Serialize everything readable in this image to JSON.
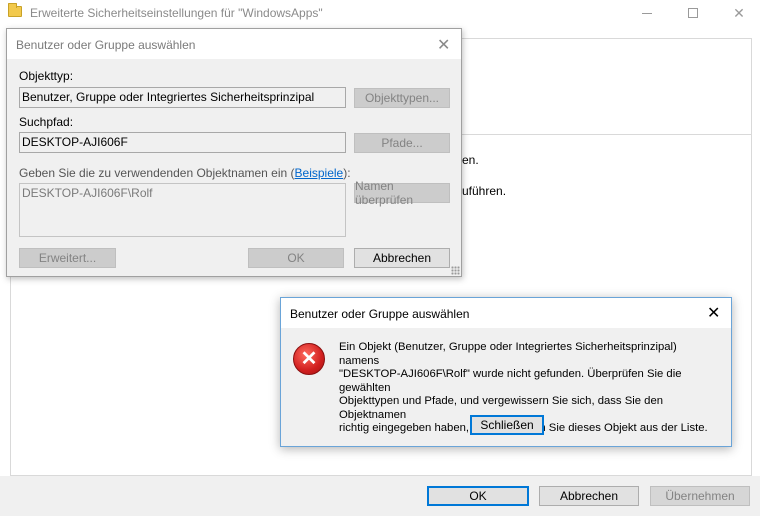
{
  "main_window": {
    "title": "Erweiterte Sicherheitseinstellungen für \"WindowsApps\"",
    "fragment_1": "en.",
    "fragment_2": "uführen.",
    "ok_label": "OK",
    "cancel_label": "Abbrechen",
    "apply_label": "Übernehmen"
  },
  "select_dialog": {
    "title": "Benutzer oder Gruppe auswählen",
    "object_type_label": "Objekttyp:",
    "object_type_value": "Benutzer, Gruppe oder Integriertes Sicherheitsprinzipal",
    "object_types_button": "Objekttypen...",
    "location_label": "Suchpfad:",
    "location_value": "DESKTOP-AJI606F",
    "locations_button": "Pfade...",
    "names_label_prefix": "Geben Sie die zu verwendenden Objektnamen ein (",
    "names_label_link": "Beispiele",
    "names_label_suffix": "):",
    "names_value": "DESKTOP-AJI606F\\Rolf",
    "check_names_button": "Namen überprüfen",
    "advanced_button": "Erweitert...",
    "ok_button": "OK",
    "cancel_button": "Abbrechen"
  },
  "error_dialog": {
    "title": "Benutzer oder Gruppe auswählen",
    "message_line_1": "Ein Objekt (Benutzer, Gruppe oder Integriertes Sicherheitsprinzipal) namens",
    "message_line_2": "\"DESKTOP-AJI606F\\Rolf\" wurde nicht gefunden. Überprüfen Sie die gewählten",
    "message_line_3": "Objekttypen und Pfade, und vergewissern Sie sich, dass Sie den Objektnamen",
    "message_line_4": "richtig eingegeben haben, oder entfernen Sie dieses Objekt aus der Liste.",
    "close_button": "Schließen"
  },
  "icons": {
    "folder": "folder-icon",
    "error": "error-icon",
    "close": "close-icon"
  },
  "colors": {
    "accent": "#0078d7",
    "link": "#0066cc",
    "error_red": "#d11f1f"
  }
}
